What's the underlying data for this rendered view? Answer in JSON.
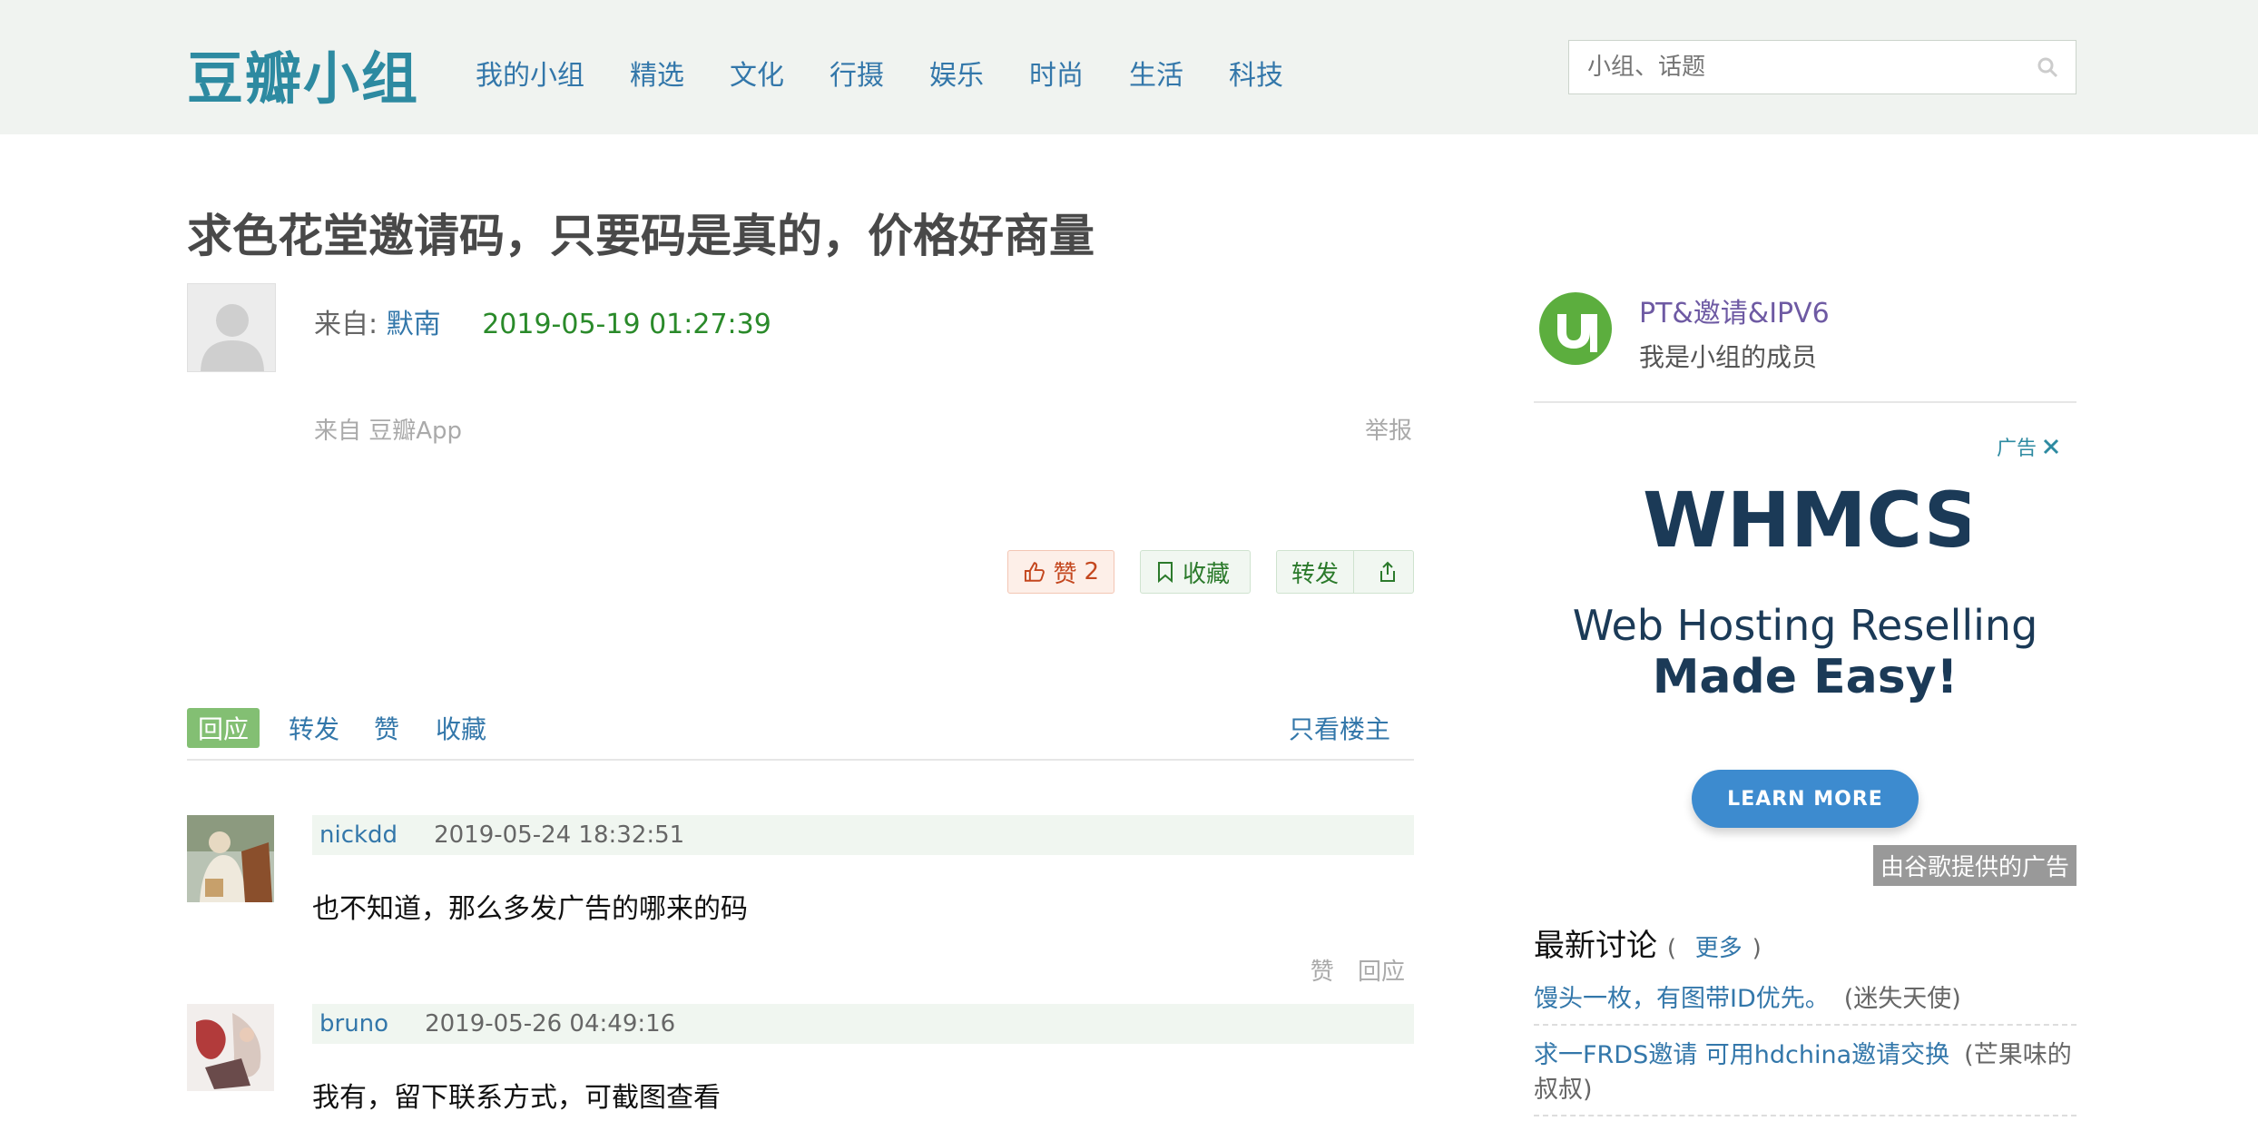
{
  "header": {
    "logo": "豆瓣小组",
    "nav": [
      "我的小组",
      "精选",
      "文化",
      "行摄",
      "娱乐",
      "时尚",
      "生活",
      "科技"
    ],
    "search_placeholder": "小组、话题"
  },
  "topic": {
    "title": "求色花堂邀请码，只要码是真的，价格好商量",
    "from_prefix": "来自:",
    "author": "默南",
    "time": "2019-05-19 01:27:39",
    "app_source": "来自 豆瓣App",
    "report": "举报",
    "like_label": "赞",
    "like_count": "2",
    "fav_label": "收藏",
    "share_label": "转发"
  },
  "tabs": {
    "items": [
      "回应",
      "转发",
      "赞",
      "收藏"
    ],
    "active": "回应",
    "only_op": "只看楼主"
  },
  "comments": [
    {
      "user": "nickdd",
      "time": "2019-05-24 18:32:51",
      "text": "也不知道，那么多发广告的哪来的码",
      "actions": [
        "赞",
        "回应"
      ]
    },
    {
      "user": "bruno",
      "time": "2019-05-26 04:49:16",
      "text": "我有，留下联系方式，可截图查看"
    }
  ],
  "sidebar": {
    "group_name": "PT&邀请&IPV6",
    "group_role": "我是小组的成员",
    "ad": {
      "tag": "广告",
      "logo_text": "WHMCS",
      "line1": "Web Hosting Reselling",
      "line2": "Made Easy!",
      "button": "LEARN MORE",
      "provided_by": "由谷歌提供的广告"
    },
    "latest": {
      "heading": "最新讨论",
      "more_open": "(",
      "more": "更多",
      "more_close": ")",
      "items": [
        {
          "title": "馒头一枚，有图带ID优先。",
          "user": "(迷失天使)"
        },
        {
          "title": "求一FRDS邀请 可用hdchina邀请交换",
          "user": "(芒果味的叔叔)"
        }
      ]
    }
  },
  "colors": {
    "link": "#3377aa",
    "logo": "#2d8aa1",
    "header_bg": "#f0f3f0",
    "time_green": "#2a8a2a",
    "tab_active_bg": "#83bf73"
  }
}
